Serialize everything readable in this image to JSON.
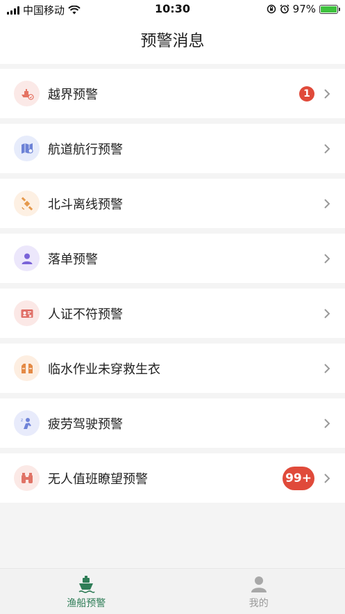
{
  "status_bar": {
    "carrier": "中国移动",
    "time": "10:30",
    "battery": "97%"
  },
  "nav": {
    "title": "预警消息"
  },
  "alerts": [
    {
      "label": "越界预警",
      "icon": "ship-boundary-icon",
      "badge": "1"
    },
    {
      "label": "航道航行预警",
      "icon": "channel-map-icon",
      "badge": ""
    },
    {
      "label": "北斗离线预警",
      "icon": "satellite-icon",
      "badge": ""
    },
    {
      "label": "落单预警",
      "icon": "person-icon",
      "badge": ""
    },
    {
      "label": "人证不符预警",
      "icon": "id-card-icon",
      "badge": ""
    },
    {
      "label": "临水作业未穿救生衣",
      "icon": "life-jacket-icon",
      "badge": ""
    },
    {
      "label": "疲劳驾驶预警",
      "icon": "fatigue-person-icon",
      "badge": ""
    },
    {
      "label": "无人值班瞭望预警",
      "icon": "binoculars-icon",
      "badge": "99+"
    }
  ],
  "tabs": [
    {
      "label": "渔船预警",
      "icon": "fishing-boat-icon",
      "active": true
    },
    {
      "label": "我的",
      "icon": "user-profile-icon",
      "active": false
    }
  ],
  "colors": {
    "accent": "#2f7d57",
    "badge": "#e04a3a",
    "battery": "#3ec23e"
  }
}
